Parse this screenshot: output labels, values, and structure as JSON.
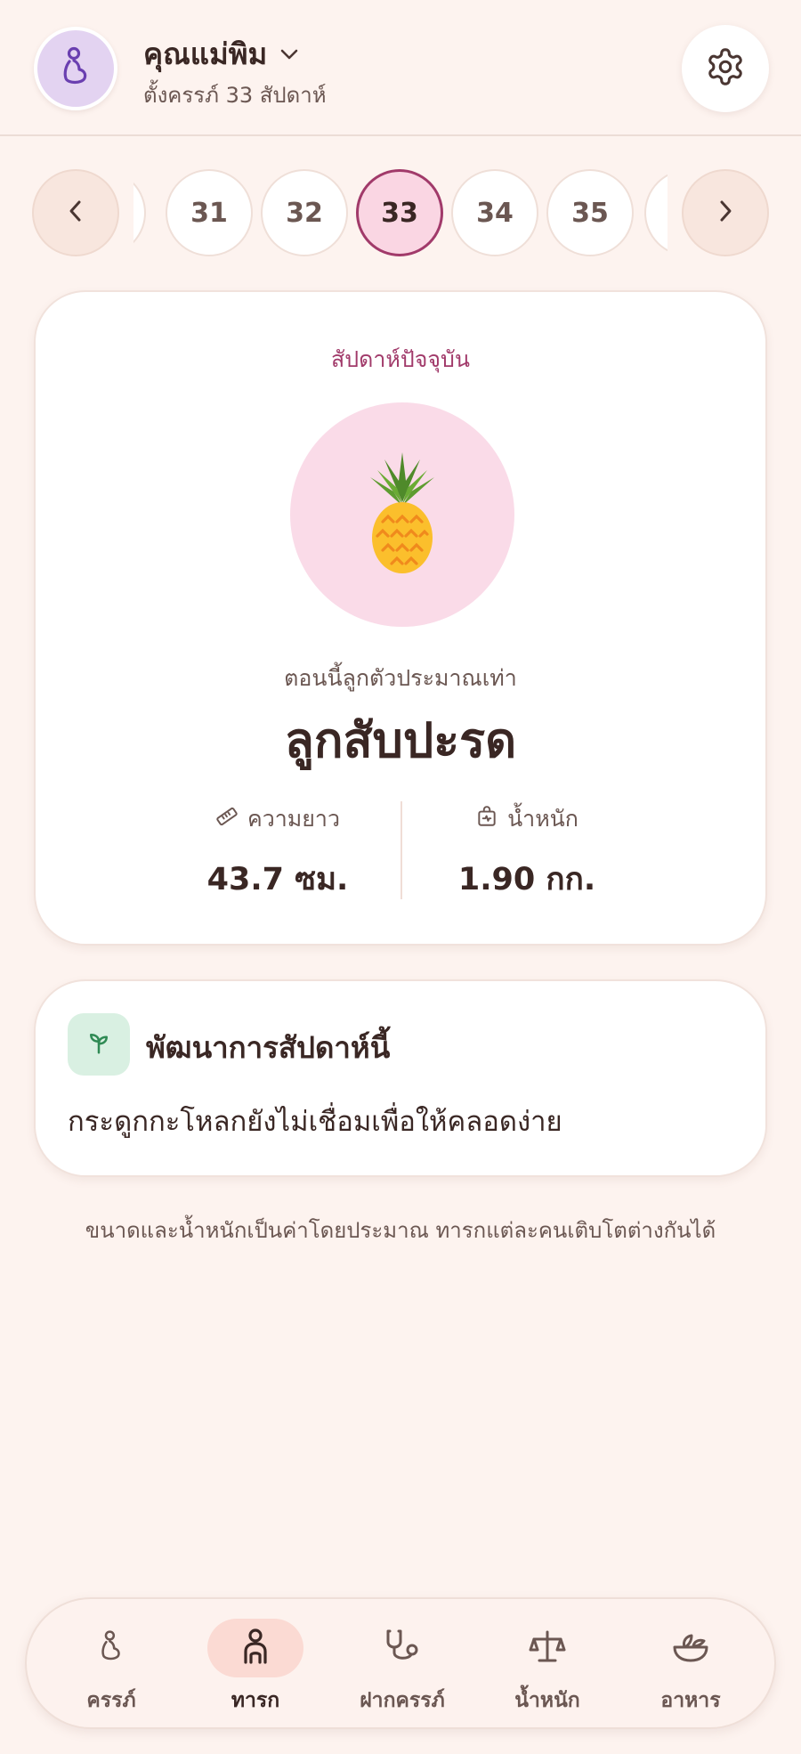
{
  "header": {
    "profile_name": "คุณแม่พิม",
    "pregnancy_status": "ตั้งครรภ์ 33 สัปดาห์"
  },
  "week_selector": {
    "weeks": [
      "31",
      "32",
      "33",
      "34",
      "35"
    ],
    "selected": "33"
  },
  "current_week_card": {
    "label": "สัปดาห์ปัจจุบัน",
    "fruit_icon": "pineapple",
    "size_caption": "ตอนนี้ลูกตัวประมาณเท่า",
    "fruit_name": "ลูกสับปะรด",
    "length_label": "ความยาว",
    "length_value": "43.7 ซม.",
    "weight_label": "น้ำหนัก",
    "weight_value": "1.90 กก."
  },
  "development_card": {
    "title": "พัฒนาการสัปดาห์นี้",
    "text": "กระดูกกะโหลกยังไม่เชื่อมเพื่อให้คลอดง่าย"
  },
  "disclaimer": "ขนาดและน้ำหนักเป็นค่าโดยประมาณ ทารกแต่ละคนเติบโตต่างกันได้",
  "bottom_nav": {
    "items": [
      {
        "label": "ครรภ์",
        "icon": "pregnancy-icon"
      },
      {
        "label": "ทารก",
        "icon": "baby-icon"
      },
      {
        "label": "ฝากครรภ์",
        "icon": "stethoscope-icon"
      },
      {
        "label": "น้ำหนัก",
        "icon": "scale-icon"
      },
      {
        "label": "อาหาร",
        "icon": "food-bowl-icon"
      }
    ],
    "active": "ทารก"
  },
  "colors": {
    "background": "#fdf3ef",
    "accent": "#a13a6a",
    "avatar_bg": "#e3d3f1",
    "fruit_circle_bg": "#fadbe8",
    "active_nav_bg": "#fbdad3"
  }
}
